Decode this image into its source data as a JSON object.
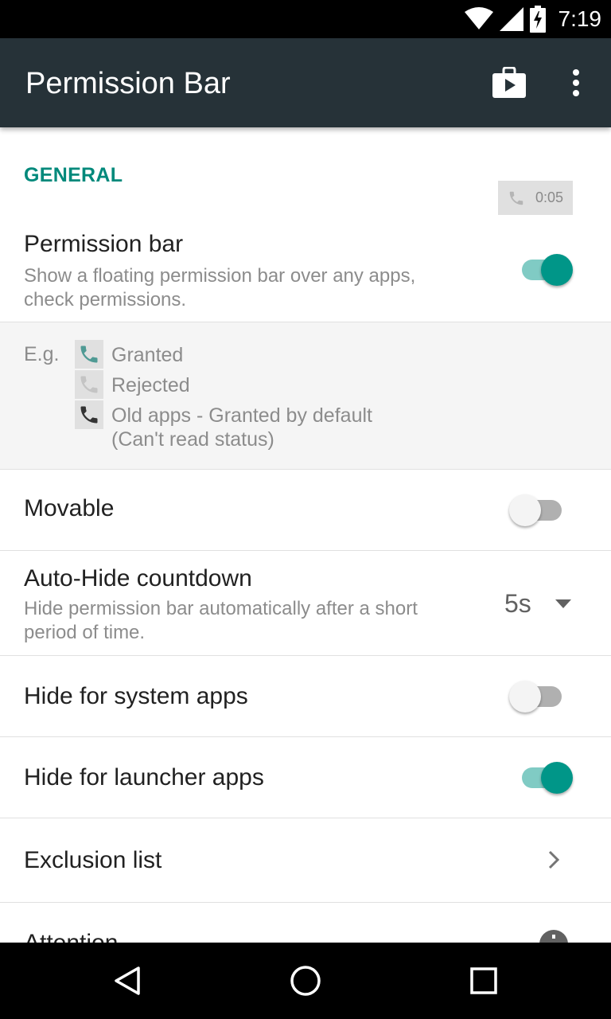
{
  "status_bar": {
    "time": "7:19",
    "icons": [
      "wifi-icon",
      "cell-signal-icon",
      "battery-charging-icon"
    ]
  },
  "app_bar": {
    "title": "Permission Bar",
    "actions": [
      "play-store-icon",
      "overflow-menu-icon"
    ]
  },
  "colors": {
    "accent": "#009688",
    "appbar": "#263238",
    "section_header": "#00897b"
  },
  "general": {
    "header": "GENERAL",
    "preview_chip": {
      "icon": "phone-icon",
      "time": "0:05"
    },
    "permission_bar": {
      "title": "Permission bar",
      "subtitle": "Show a floating permission bar over any apps, check permissions.",
      "enabled": true
    },
    "example": {
      "label": "E.g.",
      "items": [
        {
          "icon": "phone-granted-icon",
          "text": "Granted"
        },
        {
          "icon": "phone-rejected-icon",
          "text": "Rejected"
        },
        {
          "icon": "phone-old-apps-icon",
          "text": "Old apps - Granted by default",
          "note": "(Can't read status)"
        }
      ]
    },
    "movable": {
      "title": "Movable",
      "enabled": false
    },
    "auto_hide": {
      "title": "Auto-Hide countdown",
      "subtitle": "Hide permission bar automatically after a short period of time.",
      "value": "5s"
    },
    "hide_system": {
      "title": "Hide for system apps",
      "enabled": false
    },
    "hide_launcher": {
      "title": "Hide for launcher apps",
      "enabled": true
    },
    "exclusion": {
      "title": "Exclusion list"
    },
    "attention": {
      "title": "Attention"
    }
  },
  "nav_bar": {
    "buttons": [
      "back-icon",
      "home-icon",
      "recents-icon"
    ]
  }
}
